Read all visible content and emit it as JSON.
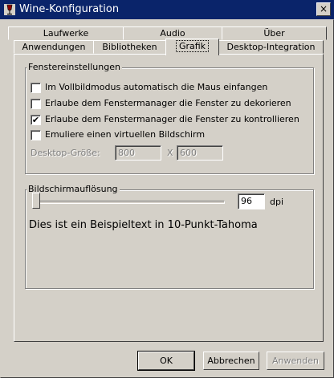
{
  "window": {
    "title": "Wine-Konfiguration",
    "close_glyph": "×",
    "icon": "wine-glass-icon"
  },
  "tabs": {
    "row1": [
      "Laufwerke",
      "Audio",
      "Über"
    ],
    "row2": [
      "Anwendungen",
      "Bibliotheken",
      "Grafik",
      "Desktop-Integration"
    ],
    "active": "Grafik"
  },
  "window_settings": {
    "group_label": "Fenstereinstellungen",
    "options": [
      {
        "label": "Im Vollbildmodus automatisch die Maus einfangen",
        "checked": false
      },
      {
        "label": "Erlaube dem Fenstermanager die Fenster zu dekorieren",
        "checked": false
      },
      {
        "label": "Erlaube dem Fenstermanager die Fenster zu kontrollieren",
        "checked": true
      },
      {
        "label": "Emuliere einen virtuellen Bildschirm",
        "checked": false
      }
    ],
    "checkmark": "✔",
    "desktop_size_label": "Desktop-Größe:",
    "width_value": "800",
    "separator": "X",
    "height_value": "600"
  },
  "resolution": {
    "group_label": "Bildschirmauflösung",
    "dpi_value": "96",
    "dpi_unit": "dpi",
    "slider_level": 0.0,
    "sample_text": "Dies ist ein Beispieltext in 10-Punkt-Tahoma"
  },
  "buttons": {
    "ok": "OK",
    "cancel": "Abbrechen",
    "apply": "Anwenden"
  }
}
